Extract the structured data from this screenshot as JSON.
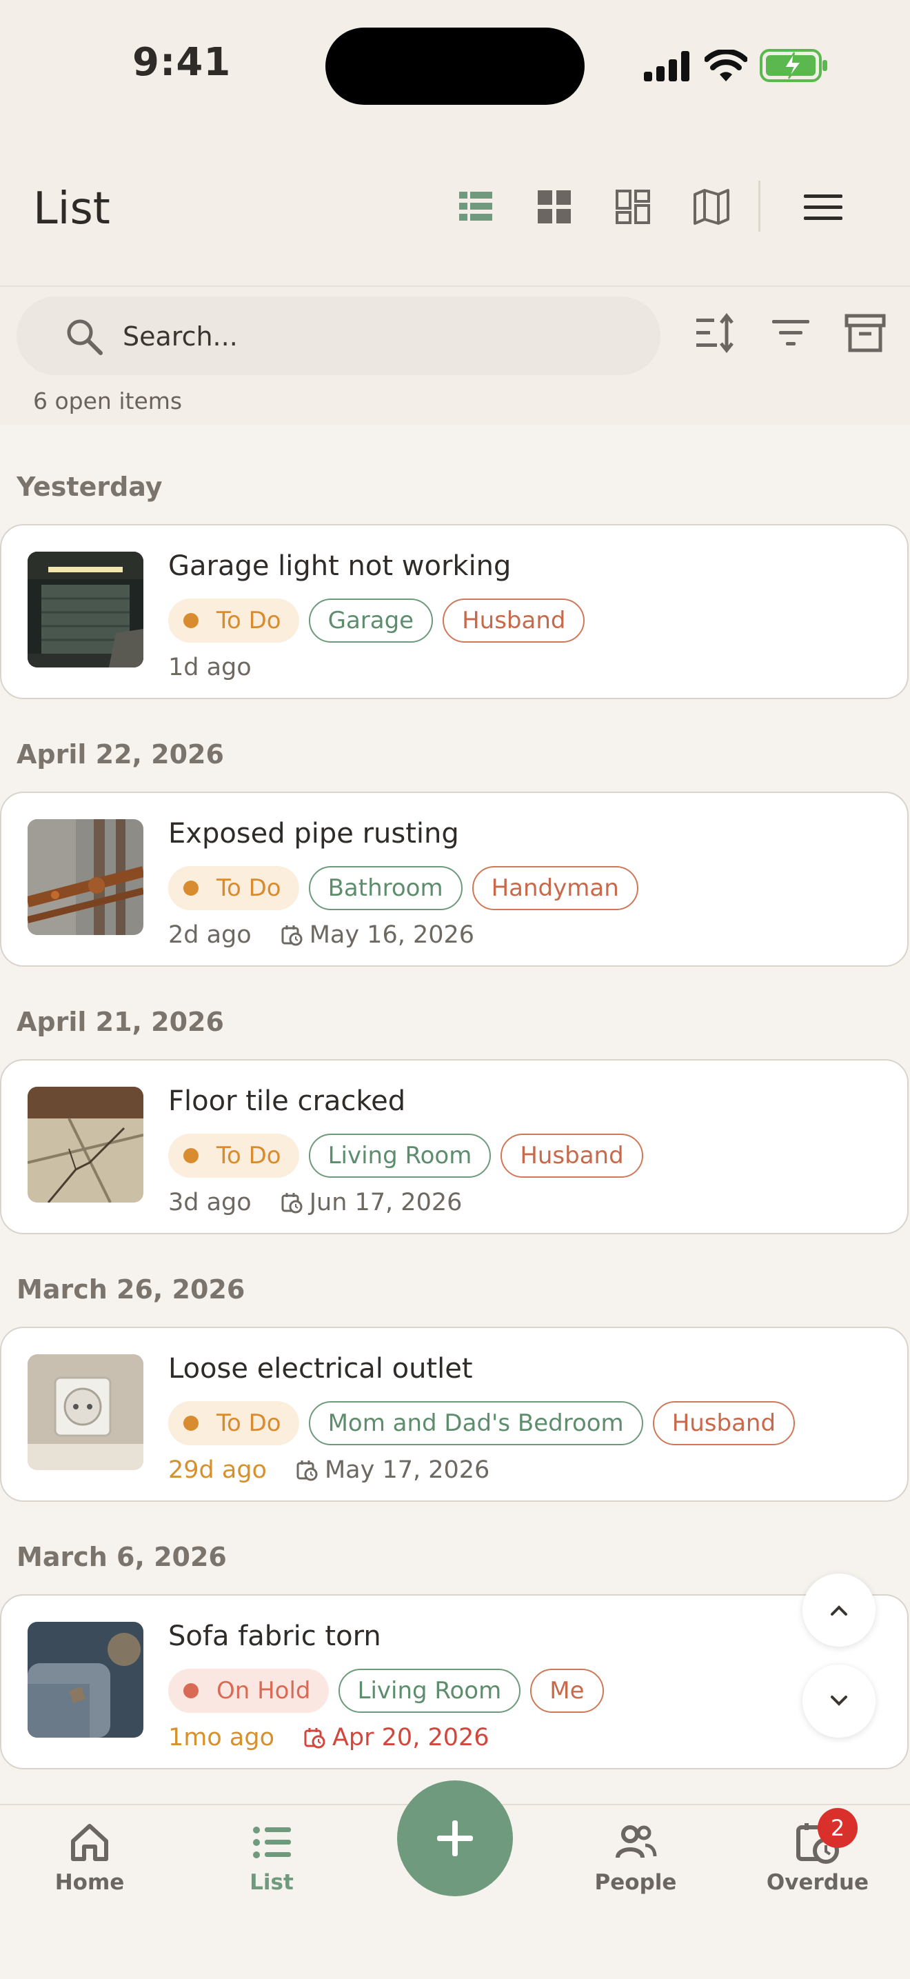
{
  "status_bar": {
    "time": "9:41"
  },
  "header": {
    "title": "List"
  },
  "search": {
    "placeholder": "Search...",
    "value": ""
  },
  "summary": {
    "count_text": "6 open items"
  },
  "colors": {
    "accent_green": "#6f9a7e",
    "todo": "#d98c2f",
    "on_hold": "#d86a56",
    "overdue_red": "#d2463b"
  },
  "sections": [
    {
      "label": "Yesterday",
      "item": {
        "title": "Garage light not working",
        "status": "To Do",
        "tags": [
          "Garage",
          "Husband"
        ],
        "ago": "1d ago",
        "due": ""
      }
    },
    {
      "label": "April 22, 2026",
      "item": {
        "title": "Exposed pipe rusting",
        "status": "To Do",
        "tags": [
          "Bathroom",
          "Handyman"
        ],
        "ago": "2d ago",
        "due": "May 16, 2026"
      }
    },
    {
      "label": "April 21, 2026",
      "item": {
        "title": "Floor tile cracked",
        "status": "To Do",
        "tags": [
          "Living Room",
          "Husband"
        ],
        "ago": "3d ago",
        "due": "Jun 17, 2026"
      }
    },
    {
      "label": "March 26, 2026",
      "item": {
        "title": "Loose electrical outlet",
        "status": "To Do",
        "tags": [
          "Mom and Dad's Bedroom",
          "Husband"
        ],
        "ago": "29d ago",
        "due": "May 17, 2026"
      }
    },
    {
      "label": "March 6, 2026",
      "item": {
        "title": "Sofa fabric torn",
        "status": "On Hold",
        "tags": [
          "Living Room",
          "Me"
        ],
        "ago": "1mo ago",
        "due": "Apr 20, 2026"
      }
    }
  ],
  "tabbar": {
    "home": "Home",
    "list": "List",
    "people": "People",
    "overdue": "Overdue",
    "overdue_badge": "2"
  }
}
